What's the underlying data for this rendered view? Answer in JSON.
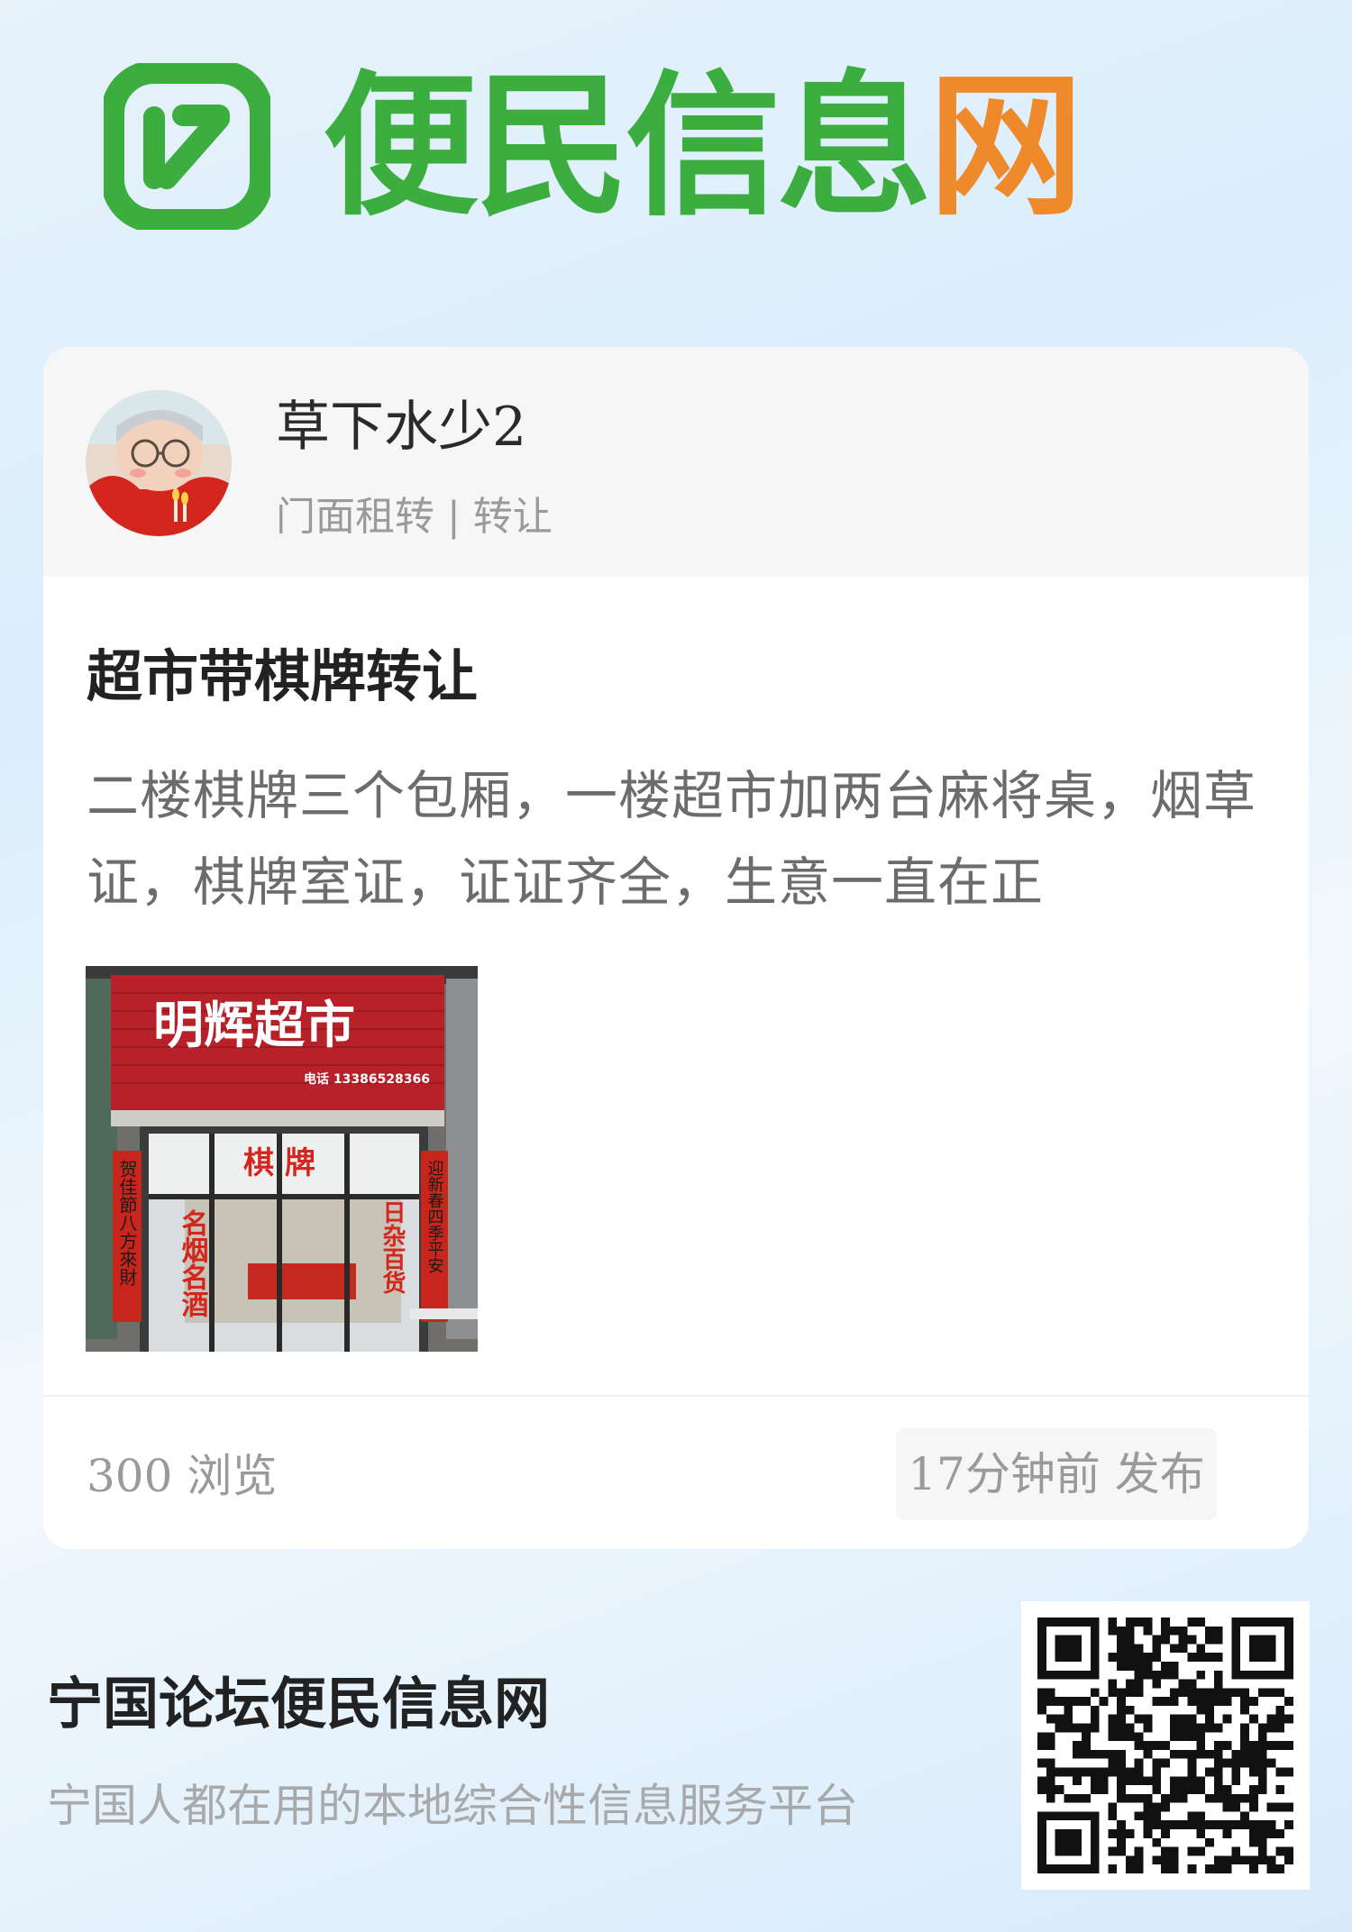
{
  "logo": {
    "text_main": "便民信息",
    "text_accent": "网",
    "colors": {
      "green": "#3cae3f",
      "orange": "#ee8a2b"
    }
  },
  "post": {
    "author": "草下水少2",
    "category": "门面租转 | 转让",
    "title": "超市带棋牌转让",
    "body": "二楼棋牌三个包厢，一楼超市加两台麻将桌，烟草证，棋牌室证，证证齐全，生意一直在正",
    "image": {
      "shop_name": "明辉超市",
      "phone": "电话 13386528366",
      "window_sign": "棋 牌",
      "left_banner": "名烟名酒",
      "right_banner": "日杂百货",
      "left_couplet": "贺佳節八方來財",
      "right_couplet": "迎新春四季平安"
    },
    "views": "300 浏览",
    "published": "17分钟前 发布"
  },
  "footer": {
    "site_name": "宁国论坛便民信息网",
    "slogan": "宁国人都在用的本地综合性信息服务平台"
  }
}
